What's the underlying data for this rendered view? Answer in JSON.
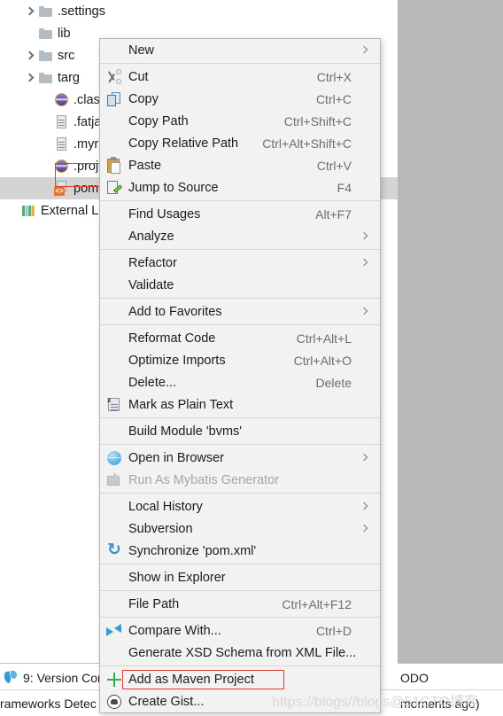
{
  "tree": {
    "rows": [
      {
        "label": ".settings",
        "icon": "folder-icon",
        "arrow": true,
        "selected": false,
        "indent": 27
      },
      {
        "label": "lib",
        "icon": "folder-icon",
        "arrow": false,
        "selected": false,
        "indent": 27
      },
      {
        "label": "src",
        "icon": "folder-icon",
        "arrow": true,
        "selected": false,
        "indent": 27
      },
      {
        "label": "targ",
        "icon": "folder-icon",
        "arrow": true,
        "selected": false,
        "indent": 27
      },
      {
        "label": ".clas",
        "icon": "sphere-icon",
        "arrow": false,
        "selected": false,
        "indent": 45
      },
      {
        "label": ".fatja",
        "icon": "file-icon",
        "arrow": false,
        "selected": false,
        "indent": 45
      },
      {
        "label": ".myr",
        "icon": "file-icon",
        "arrow": false,
        "selected": false,
        "indent": 45
      },
      {
        "label": ".proj",
        "icon": "sphere-icon",
        "arrow": false,
        "selected": false,
        "indent": 45
      },
      {
        "label": "pom",
        "icon": "pom-icon",
        "arrow": false,
        "selected": true,
        "indent": 45
      },
      {
        "label": "External Lib",
        "icon": "library-icon",
        "arrow": false,
        "selected": false,
        "indent": 8
      }
    ]
  },
  "context_menu": {
    "items": [
      {
        "label": "New",
        "accel": "",
        "icon": "",
        "submenu": true,
        "disabled": false,
        "sep_after": true
      },
      {
        "label": "Cut",
        "accel": "Ctrl+X",
        "icon": "cut-icon",
        "submenu": false,
        "disabled": false,
        "sep_after": false
      },
      {
        "label": "Copy",
        "accel": "Ctrl+C",
        "icon": "copy-icon",
        "submenu": false,
        "disabled": false,
        "sep_after": false
      },
      {
        "label": "Copy Path",
        "accel": "Ctrl+Shift+C",
        "icon": "",
        "submenu": false,
        "disabled": false,
        "sep_after": false
      },
      {
        "label": "Copy Relative Path",
        "accel": "Ctrl+Alt+Shift+C",
        "icon": "",
        "submenu": false,
        "disabled": false,
        "sep_after": false
      },
      {
        "label": "Paste",
        "accel": "Ctrl+V",
        "icon": "paste-icon",
        "submenu": false,
        "disabled": false,
        "sep_after": false
      },
      {
        "label": "Jump to Source",
        "accel": "F4",
        "icon": "jump-to-source-icon",
        "submenu": false,
        "disabled": false,
        "sep_after": true
      },
      {
        "label": "Find Usages",
        "accel": "Alt+F7",
        "icon": "",
        "submenu": false,
        "disabled": false,
        "sep_after": false
      },
      {
        "label": "Analyze",
        "accel": "",
        "icon": "",
        "submenu": true,
        "disabled": false,
        "sep_after": true
      },
      {
        "label": "Refactor",
        "accel": "",
        "icon": "",
        "submenu": true,
        "disabled": false,
        "sep_after": false
      },
      {
        "label": "Validate",
        "accel": "",
        "icon": "",
        "submenu": false,
        "disabled": false,
        "sep_after": true
      },
      {
        "label": "Add to Favorites",
        "accel": "",
        "icon": "",
        "submenu": true,
        "disabled": false,
        "sep_after": true
      },
      {
        "label": "Reformat Code",
        "accel": "Ctrl+Alt+L",
        "icon": "",
        "submenu": false,
        "disabled": false,
        "sep_after": false
      },
      {
        "label": "Optimize Imports",
        "accel": "Ctrl+Alt+O",
        "icon": "",
        "submenu": false,
        "disabled": false,
        "sep_after": false
      },
      {
        "label": "Delete...",
        "accel": "Delete",
        "icon": "",
        "submenu": false,
        "disabled": false,
        "sep_after": false
      },
      {
        "label": "Mark as Plain Text",
        "accel": "",
        "icon": "plain-text-icon",
        "submenu": false,
        "disabled": false,
        "sep_after": true
      },
      {
        "label": "Build Module 'bvms'",
        "accel": "",
        "icon": "",
        "submenu": false,
        "disabled": false,
        "sep_after": true
      },
      {
        "label": "Open in Browser",
        "accel": "",
        "icon": "globe-icon",
        "submenu": true,
        "disabled": false,
        "sep_after": false
      },
      {
        "label": "Run As Mybatis Generator",
        "accel": "",
        "icon": "mybatis-icon",
        "submenu": false,
        "disabled": true,
        "sep_after": true
      },
      {
        "label": "Local History",
        "accel": "",
        "icon": "",
        "submenu": true,
        "disabled": false,
        "sep_after": false
      },
      {
        "label": "Subversion",
        "accel": "",
        "icon": "",
        "submenu": true,
        "disabled": false,
        "sep_after": false
      },
      {
        "label": "Synchronize 'pom.xml'",
        "accel": "",
        "icon": "sync-icon",
        "submenu": false,
        "disabled": false,
        "sep_after": true
      },
      {
        "label": "Show in Explorer",
        "accel": "",
        "icon": "",
        "submenu": false,
        "disabled": false,
        "sep_after": true
      },
      {
        "label": "File Path",
        "accel": "Ctrl+Alt+F12",
        "icon": "",
        "submenu": false,
        "disabled": false,
        "sep_after": true
      },
      {
        "label": "Compare With...",
        "accel": "Ctrl+D",
        "icon": "compare-icon",
        "submenu": false,
        "disabled": false,
        "sep_after": false
      },
      {
        "label": "Generate XSD Schema from XML File...",
        "accel": "",
        "icon": "",
        "submenu": false,
        "disabled": false,
        "sep_after": true
      },
      {
        "label": "Add as Maven Project",
        "accel": "",
        "icon": "plus-icon",
        "submenu": false,
        "disabled": false,
        "sep_after": false,
        "highlighted": true
      },
      {
        "label": "Create Gist...",
        "accel": "",
        "icon": "gist-icon",
        "submenu": false,
        "disabled": false,
        "sep_after": false
      }
    ]
  },
  "statusbar": {
    "version_control": "9: Version Con",
    "frameworks": "rameworks Detec",
    "todo": "ODO",
    "moments": "moments ago)"
  },
  "watermark": "https://blogs//blogs@51CTO博客",
  "colors": {
    "menu_bg": "#f2f2f2",
    "menu_border": "#b4b4b4",
    "annotation_red": "#e23b30",
    "selection_gray": "#d4d4d4",
    "panel_gray": "#b8b8b8",
    "accel_text": "#6d6d6d",
    "disabled_text": "#a6a6a6"
  }
}
